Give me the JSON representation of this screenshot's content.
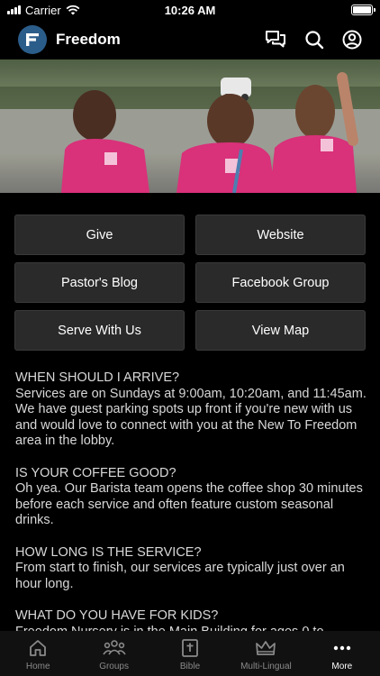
{
  "status_bar": {
    "carrier": "Carrier",
    "time": "10:26 AM"
  },
  "header": {
    "title": "Freedom",
    "icons": [
      "chat-icon",
      "search-icon",
      "profile-icon"
    ]
  },
  "hero": {
    "description_icon": "hero-image"
  },
  "buttons": [
    {
      "label": "Give"
    },
    {
      "label": "Website"
    },
    {
      "label": "Pastor's Blog"
    },
    {
      "label": "Facebook Group"
    },
    {
      "label": "Serve With Us"
    },
    {
      "label": "View Map"
    }
  ],
  "faq": [
    {
      "q": "WHEN SHOULD I ARRIVE?",
      "a": "Services are on Sundays at 9:00am, 10:20am, and 11:45am. We have guest parking spots up front if you're new with us and would love to connect with you at the New To Freedom area in the lobby."
    },
    {
      "q": "IS YOUR COFFEE GOOD?",
      "a": "Oh yea. Our Barista team opens the coffee shop 30 minutes before each service and often feature custom seasonal drinks."
    },
    {
      "q": "HOW LONG IS THE SERVICE?",
      "a": "From start to finish, our services are typically just over an hour long."
    },
    {
      "q": "WHAT DO YOU HAVE FOR KIDS?",
      "a": "Freedom Nursery is in the Main Building for ages 0 to"
    }
  ],
  "tabs": [
    {
      "label": "Home",
      "icon": "home-icon"
    },
    {
      "label": "Groups",
      "icon": "groups-icon"
    },
    {
      "label": "Bible",
      "icon": "bible-icon"
    },
    {
      "label": "Multi-Lingual",
      "icon": "crown-icon"
    },
    {
      "label": "More",
      "icon": "more-icon",
      "active": true
    }
  ],
  "colors": {
    "background": "#000000",
    "button": "#2a2a2a",
    "logo": "#2b5d8a",
    "shirt": "#d9317a"
  }
}
